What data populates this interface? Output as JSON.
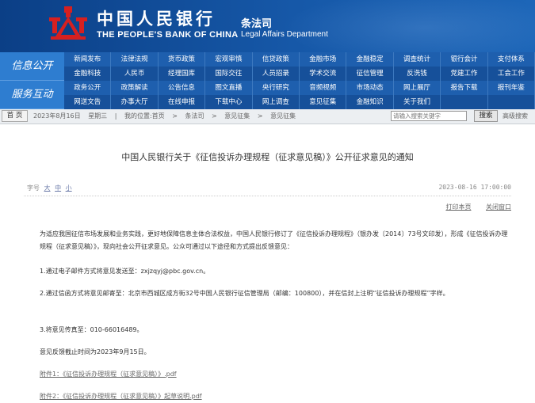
{
  "header": {
    "bank_cn": "中国人民银行",
    "bank_en": "THE PEOPLE'S BANK OF CHINA",
    "dept_cn": "条法司",
    "dept_en": "Legal Affairs Department",
    "logo_icon": "pboc-emblem-icon",
    "brand_color": "#d62020"
  },
  "nav": {
    "group1_label": "信息公开",
    "group2_label": "服务互动",
    "rows": [
      [
        "新闻发布",
        "法律法规",
        "货币政策",
        "宏观审慎",
        "信贷政策",
        "金融市场",
        "金融稳定",
        "调查统计",
        "银行会计",
        "支付体系"
      ],
      [
        "金融科技",
        "人民币",
        "经理国库",
        "国际交往",
        "人员招录",
        "学术交流",
        "征信管理",
        "反洗钱",
        "党建工作",
        "工会工作"
      ],
      [
        "政务公开",
        "政策解读",
        "公告信息",
        "图文直播",
        "央行研究",
        "音频视频",
        "市场动态",
        "网上展厅",
        "报告下载",
        "报刊年鉴"
      ],
      [
        "网送文告",
        "办事大厅",
        "在线申报",
        "下载中心",
        "网上调查",
        "意见征集",
        "金融知识",
        "关于我们",
        "",
        ""
      ]
    ]
  },
  "crumbbar": {
    "home": "首 页",
    "date": "2023年8月16日",
    "weekday": "星期三",
    "location_label": "我的位置:首页",
    "sep": ">",
    "crumb1": "条法司",
    "crumb2": "意见征集",
    "crumb3": "意见征集",
    "search_placeholder": "请输入搜索关键字",
    "search_button": "搜索",
    "advanced_search": "高级搜索"
  },
  "article": {
    "title": "中国人民银行关于《征信投诉办理规程（征求意见稿）》公开征求意见的通知",
    "font_size_label": "字号",
    "font_large": "大",
    "font_medium": "中",
    "font_small": "小",
    "date": "2023-08-16  17:00:00",
    "print_label": "打印本页",
    "close_label": "关闭窗口",
    "paragraphs": [
      "为适应我国征信市场发展和业务实践，更好地保障信息主体合法权益，中国人民银行修订了《征信投诉办理规程》（银办发〔2014〕73号文印发），形成《征信投诉办理规程（征求意见稿）》，现向社会公开征求意见。公众可通过以下途径和方式提出反馈意见：",
      "1.通过电子邮件方式将意见发送至：zxjzqyj@pbc.gov.cn。",
      "2.通过信函方式将意见邮寄至：北京市西城区成方街32号中国人民银行征信管理局（邮编：100800），并在信封上注明“征信投诉办理规程”字样。",
      "3.将意见传真至：010-66016489。",
      "意见反馈截止时间为2023年9月15日。"
    ],
    "attachment1": "附件1：《征信投诉办理规程（征求意见稿）》.pdf",
    "attachment2": "附件2：《征信投诉办理规程（征求意见稿）》起草说明.pdf"
  }
}
